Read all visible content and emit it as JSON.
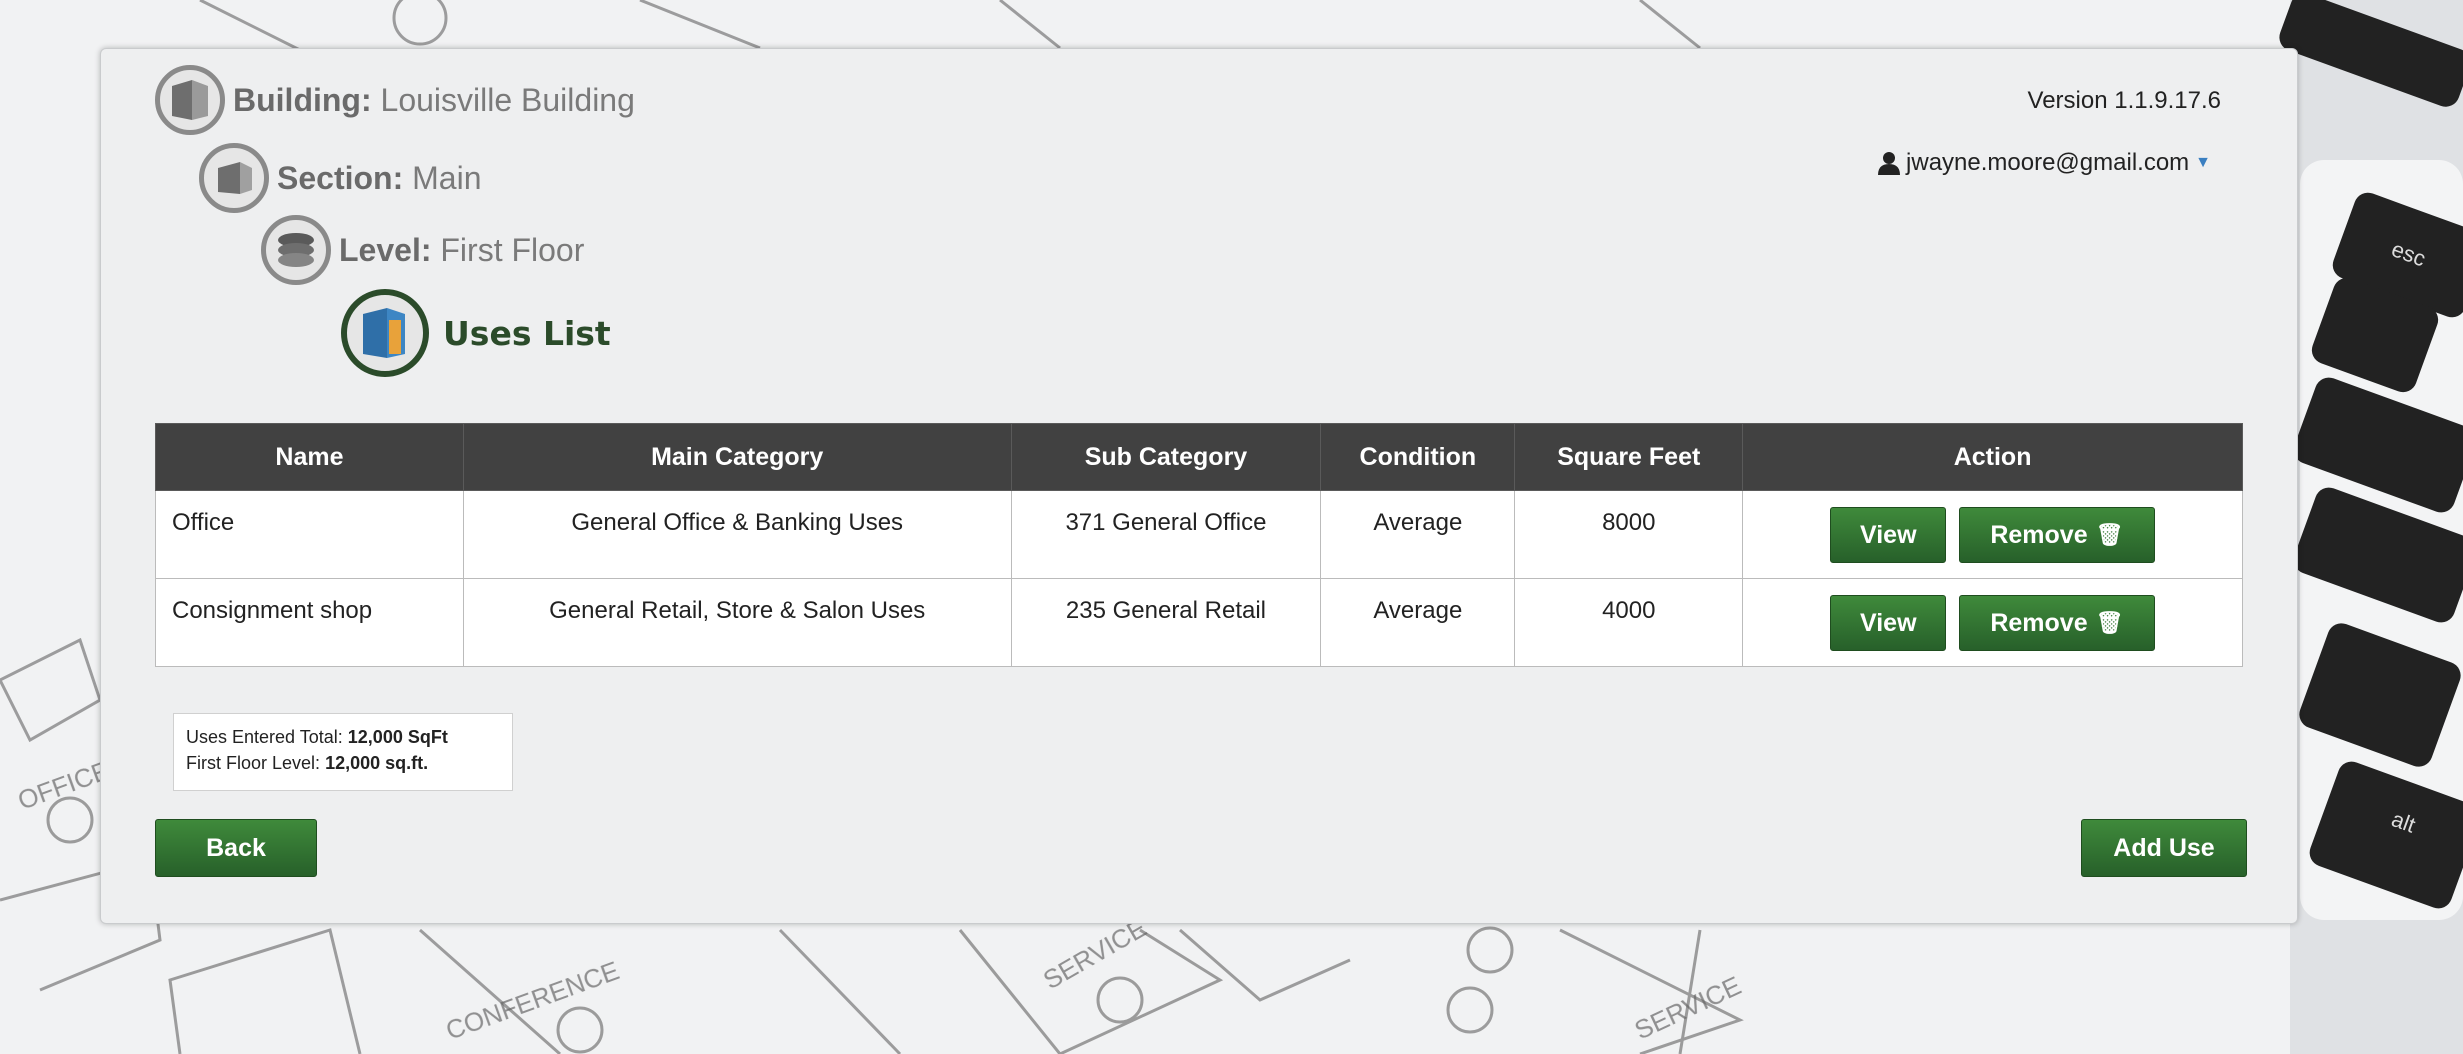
{
  "breadcrumb": {
    "building": {
      "label": "Building:",
      "value": "Louisville Building"
    },
    "section": {
      "label": "Section:",
      "value": "Main"
    },
    "level": {
      "label": "Level:",
      "value": "First Floor"
    },
    "current": "Uses List"
  },
  "header": {
    "version": "Version 1.1.9.17.6",
    "user_email": "jwayne.moore@gmail.com"
  },
  "table": {
    "columns": [
      "Name",
      "Main Category",
      "Sub Category",
      "Condition",
      "Square Feet",
      "Action"
    ],
    "rows": [
      {
        "name": "Office",
        "main_category": "General Office & Banking Uses",
        "sub_category": "371 General Office",
        "condition": "Average",
        "square_feet": "8000"
      },
      {
        "name": "Consignment shop",
        "main_category": "General Retail, Store & Salon Uses",
        "sub_category": "235 General Retail",
        "condition": "Average",
        "square_feet": "4000"
      }
    ],
    "view_label": "View",
    "remove_label": "Remove"
  },
  "summary": {
    "uses_label": "Uses Entered Total:",
    "uses_value": "12,000 SqFt",
    "level_label": "First Floor Level:",
    "level_value": "12,000 sq.ft."
  },
  "buttons": {
    "back": "Back",
    "add_use": "Add Use"
  },
  "background_labels": [
    "OFFICE",
    "CONFERENCE",
    "SERVICE",
    "SERVICE",
    "esc",
    "alt"
  ],
  "colors": {
    "accent_green": "#2f6f2d",
    "table_header": "#414141",
    "link_blue": "#3a7fc1"
  }
}
